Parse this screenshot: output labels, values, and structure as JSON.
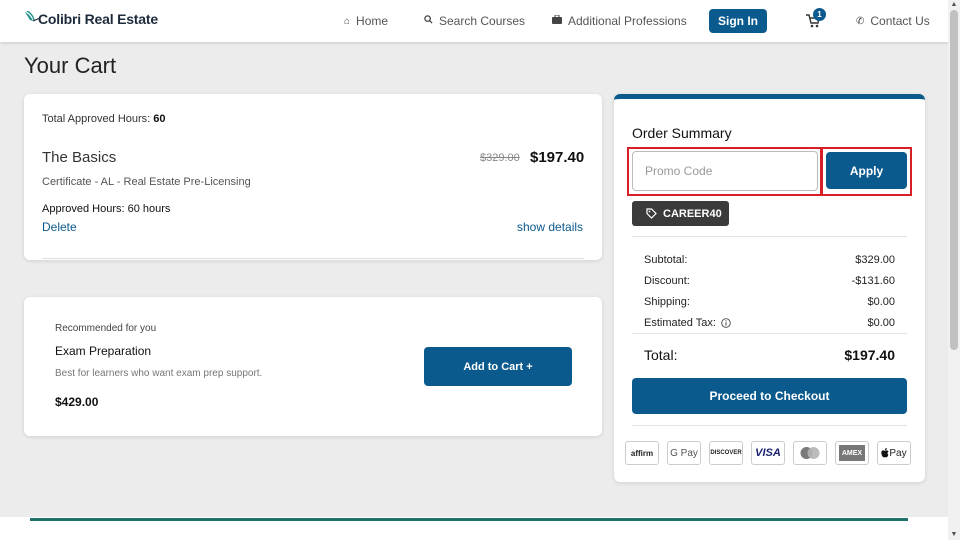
{
  "header": {
    "brand": "Colibri Real Estate",
    "nav": {
      "home": "Home",
      "search_courses": "Search Courses",
      "additional_professions": "Additional Professions",
      "sign_in": "Sign In",
      "cart_count": "1",
      "contact_us": "Contact Us"
    }
  },
  "page": {
    "title": "Your Cart"
  },
  "cart_item": {
    "total_hours_label": "Total Approved Hours:",
    "total_hours_value": "60",
    "course_name": "The Basics",
    "original_price": "$329.00",
    "price": "$197.40",
    "certificate": "Certificate - AL - Real Estate Pre-Licensing",
    "approved_hours": "Approved Hours: 60 hours",
    "delete_label": "Delete",
    "show_details_label": "show details"
  },
  "recommended": {
    "heading": "Recommended for you",
    "title": "Exam Preparation",
    "description": "Best for learners who want exam prep support.",
    "price": "$429.00",
    "add_to_cart_label": "Add to Cart +"
  },
  "summary": {
    "title": "Order Summary",
    "promo_placeholder": "Promo Code",
    "apply_label": "Apply",
    "coupon_code": "CAREER40",
    "rows": [
      {
        "label": "Subtotal:",
        "value": "$329.00"
      },
      {
        "label": "Discount:",
        "value": "-$131.60"
      },
      {
        "label": "Shipping:",
        "value": "$0.00"
      },
      {
        "label": "Estimated Tax:",
        "value": "$0.00"
      }
    ],
    "total_label": "Total:",
    "total_value": "$197.40",
    "checkout_label": "Proceed to Checkout",
    "payment_methods": {
      "affirm": "affirm",
      "gpay": "G Pay",
      "discover": "DISCOVER",
      "visa": "VISA",
      "amex": "AMEX",
      "apple_pay": "Pay"
    }
  },
  "colors": {
    "primary": "#0b5a8e",
    "highlight": "#d81f26",
    "coupon_bg": "#3b3b3b",
    "footer_accent": "#1f6f6a"
  }
}
